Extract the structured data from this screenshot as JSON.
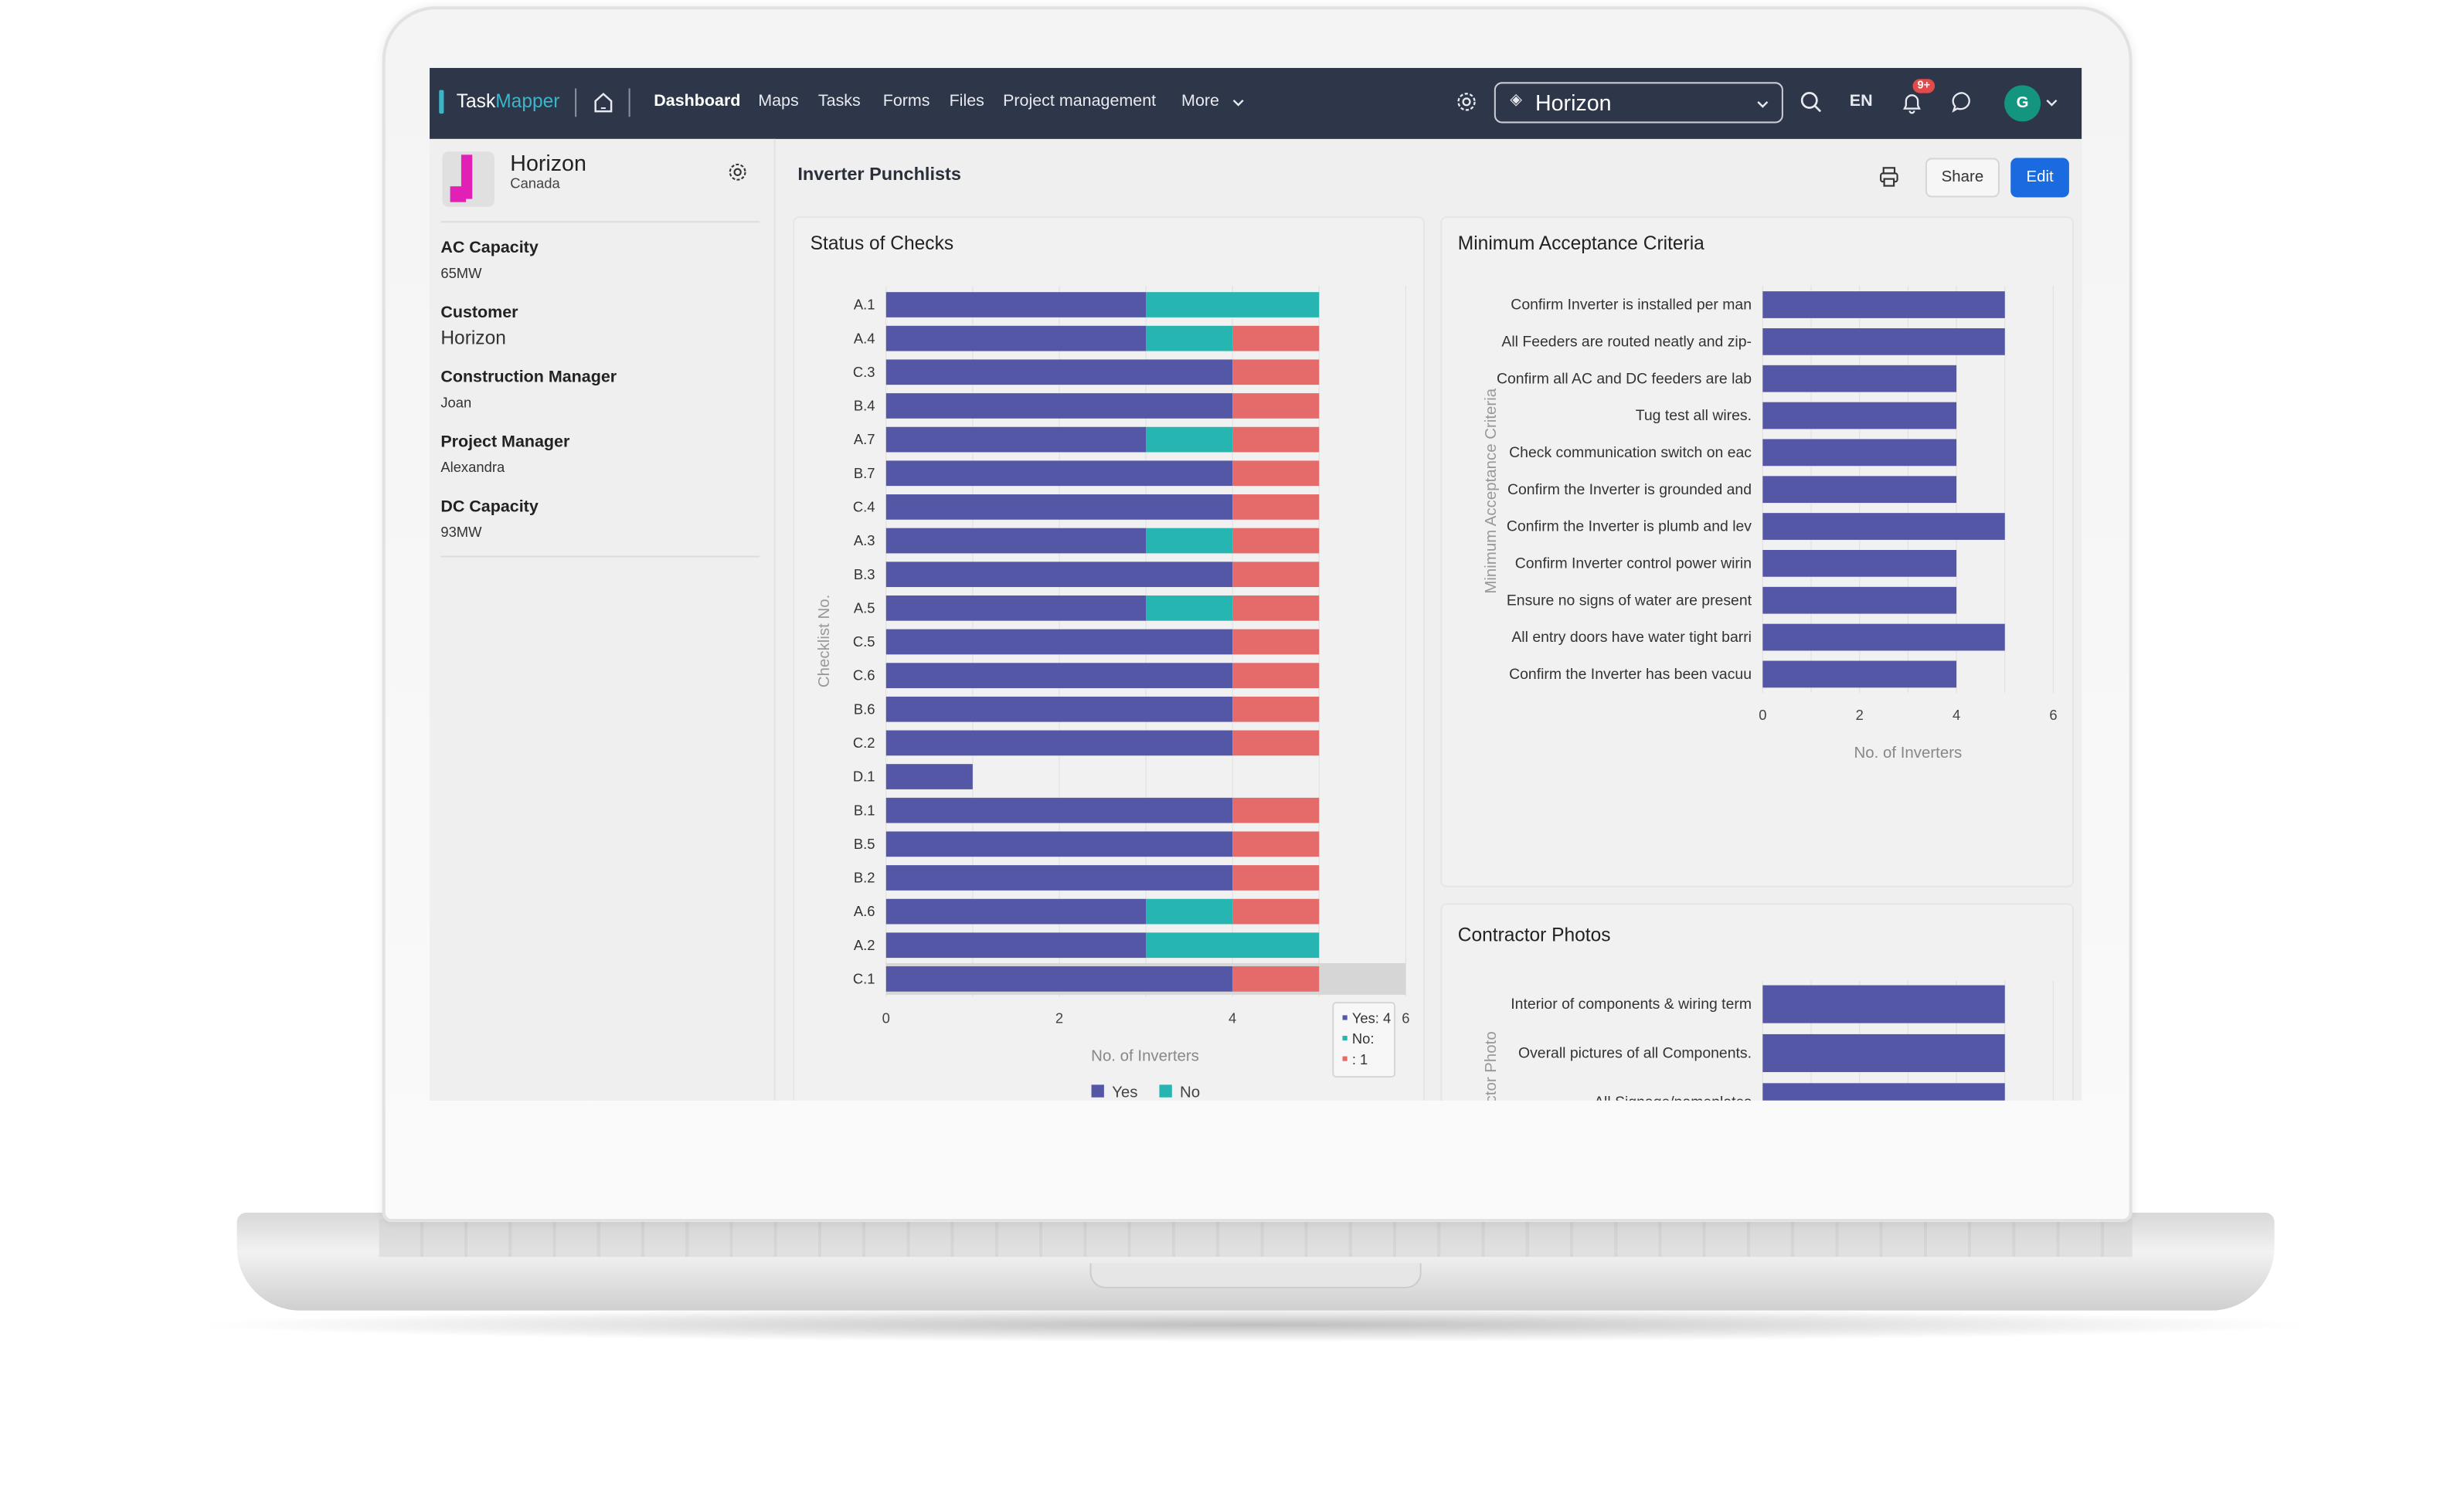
{
  "nav": {
    "brand_a": "Task",
    "brand_b": "Mapper",
    "items": [
      "Dashboard",
      "Maps",
      "Tasks",
      "Forms",
      "Files",
      "Project management",
      "More"
    ],
    "project_selector": "Horizon",
    "language": "EN",
    "notification_badge": "9+",
    "avatar_initial": "G"
  },
  "sidebar": {
    "project_name": "Horizon",
    "project_location": "Canada",
    "fields": [
      {
        "label": "AC Capacity",
        "value": "65MW"
      },
      {
        "label": "Customer",
        "value": "Horizon"
      },
      {
        "label": "Construction Manager",
        "value": "Joan"
      },
      {
        "label": "Project Manager",
        "value": "Alexandra"
      },
      {
        "label": "DC Capacity",
        "value": "93MW"
      }
    ]
  },
  "header": {
    "title": "Inverter Punchlists",
    "share_label": "Share",
    "edit_label": "Edit"
  },
  "colors": {
    "yes": "#5457a6",
    "no": "#26b5b0",
    "unlabeled": "#e56b6b",
    "nav": "#2e3649",
    "edit": "#1a6ae0"
  },
  "chart_data": [
    {
      "type": "bar",
      "orientation": "horizontal",
      "stacked": true,
      "title": "Status of Checks",
      "xlabel": "No. of Inverters",
      "ylabel": "Checklist No.",
      "xlim": [
        0,
        6
      ],
      "xticks": [
        "0",
        "2",
        "4",
        "6"
      ],
      "legend": "bottom",
      "categories": [
        "A.1",
        "A.4",
        "C.3",
        "B.4",
        "A.7",
        "B.7",
        "C.4",
        "A.3",
        "B.3",
        "A.5",
        "C.5",
        "C.6",
        "B.6",
        "C.2",
        "D.1",
        "B.1",
        "B.5",
        "B.2",
        "A.6",
        "A.2",
        "C.1"
      ],
      "series": [
        {
          "name": "Yes",
          "color": "#5457a6",
          "values": [
            3,
            3,
            4,
            4,
            3,
            4,
            4,
            3,
            4,
            3,
            4,
            4,
            4,
            4,
            1,
            4,
            4,
            4,
            3,
            3,
            4
          ]
        },
        {
          "name": "No",
          "color": "#26b5b0",
          "values": [
            2,
            1,
            0,
            0,
            1,
            0,
            0,
            1,
            0,
            1,
            0,
            0,
            0,
            0,
            0,
            0,
            0,
            0,
            1,
            2,
            0
          ]
        },
        {
          "name": "",
          "color": "#e56b6b",
          "values": [
            0,
            1,
            1,
            1,
            1,
            1,
            1,
            1,
            1,
            1,
            1,
            1,
            1,
            1,
            0,
            1,
            1,
            1,
            1,
            0,
            1
          ]
        }
      ],
      "highlighted": "C.1",
      "tooltip": [
        "Yes: 4",
        "No:",
        ": 1"
      ]
    },
    {
      "type": "bar",
      "orientation": "horizontal",
      "title": "Minimum Acceptance Criteria",
      "xlabel": "No. of Inverters",
      "ylabel": "Minimum Acceptance Criteria",
      "xlim": [
        0,
        6
      ],
      "xticks": [
        "0",
        "2",
        "4",
        "6"
      ],
      "categories": [
        "Confirm Inverter is installed per man",
        "All Feeders are routed neatly and zip-",
        "Confirm all AC and DC feeders are lab",
        "Tug test all wires.",
        "Check communication switch on eac",
        "Confirm the Inverter is grounded and",
        "Confirm the Inverter is plumb and lev",
        "Confirm Inverter control power wirin",
        "Ensure no signs of water are present",
        "All entry doors have water tight barri",
        "Confirm the Inverter has been vacuu"
      ],
      "values": [
        5,
        5,
        4,
        4,
        4,
        4,
        5,
        4,
        4,
        5,
        4
      ],
      "color": "#5457a6"
    },
    {
      "type": "bar",
      "orientation": "horizontal",
      "title": "Contractor Photos",
      "ylabel": "Contractor Photo",
      "xlim": [
        0,
        6
      ],
      "categories": [
        "Interior of components & wiring term",
        "Overall pictures of all Components.",
        "All Signage/nameplates"
      ],
      "values": [
        5,
        5,
        5
      ],
      "color": "#5457a6"
    }
  ]
}
